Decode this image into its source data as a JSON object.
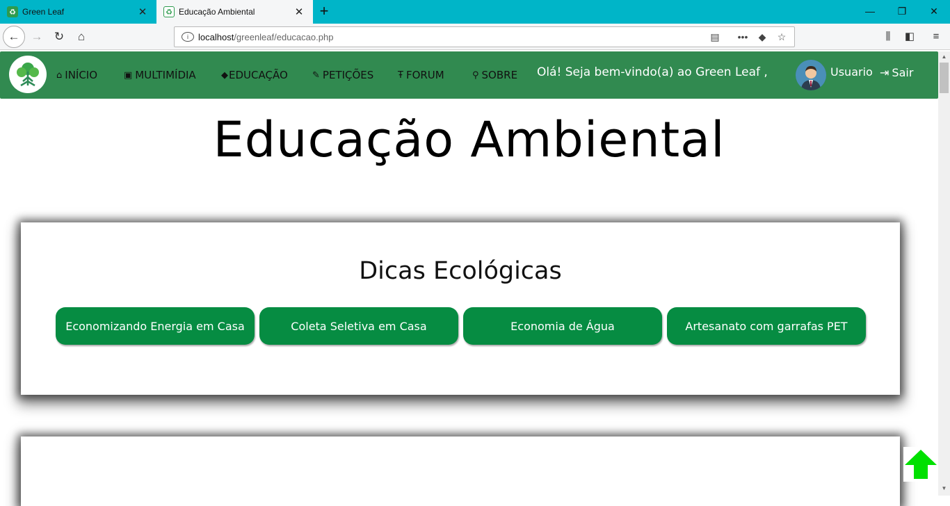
{
  "browser": {
    "tabs": [
      {
        "title": "Green Leaf"
      },
      {
        "title": "Educação Ambiental"
      }
    ],
    "url_host": "localhost",
    "url_path": "/greenleaf/educacao.php"
  },
  "header": {
    "menu": [
      {
        "label": "INÍCIO",
        "icon": "home-icon"
      },
      {
        "label": "MULTIMÍDIA",
        "icon": "image-icon"
      },
      {
        "label": "EDUCAÇÃO",
        "icon": "graduation-cap-icon"
      },
      {
        "label": "PETIÇÕES",
        "icon": "pencil-icon"
      },
      {
        "label": "FORUM",
        "icon": "text-icon"
      },
      {
        "label": "SOBRE",
        "icon": "search-icon"
      }
    ],
    "welcome": "Olá! Seja bem-vindo(a) ao Green Leaf ,",
    "username": "Usuario",
    "logout": "Sair"
  },
  "main": {
    "title": "Educação Ambiental",
    "tips_title": "Dicas Ecológicas",
    "tips": [
      "Economizando Energia em Casa",
      "Coleta Seletiva em Casa",
      "Economia de Água",
      "Artesanato com garrafas PET"
    ]
  },
  "colors": {
    "header_bg": "#318a50",
    "button_bg": "#068c42",
    "tabstrip": "#00b5c8",
    "scroll_top_arrow": "#00e000"
  }
}
